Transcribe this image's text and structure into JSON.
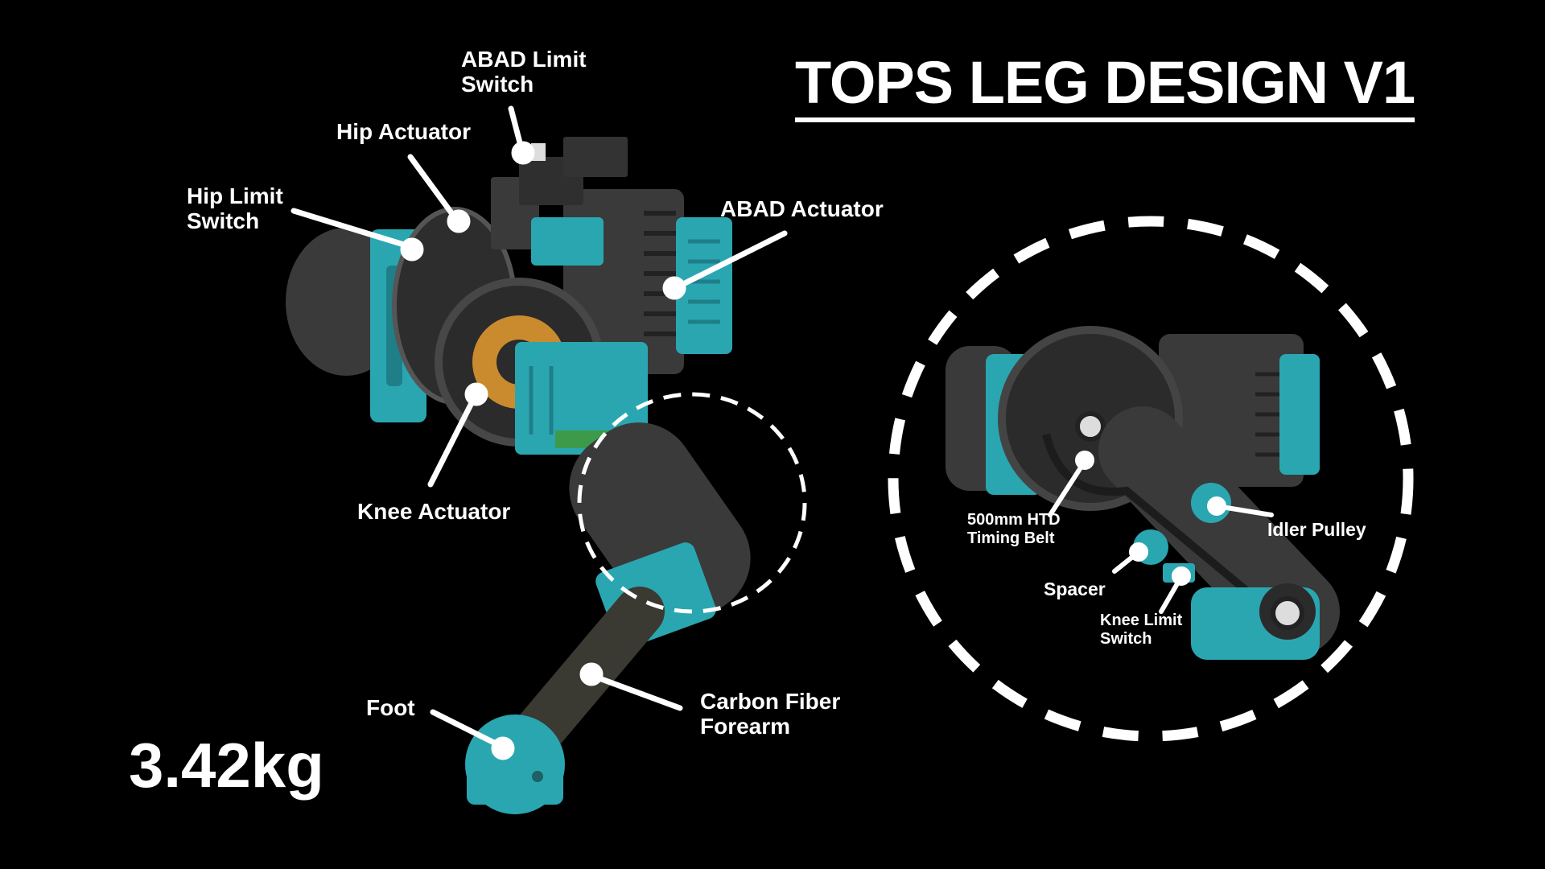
{
  "title": "TOPS LEG DESIGN V1",
  "mass": "3.42kg",
  "colors": {
    "background": "#000000",
    "accent_teal": "#2aa6b1",
    "dark_part": "#3a3a3a",
    "motor_copper": "#c98b2e",
    "text": "#ffffff"
  },
  "callouts": {
    "abad_limit_switch": [
      "ABAD Limit",
      "Switch"
    ],
    "hip_actuator": "Hip Actuator",
    "hip_limit_switch": [
      "Hip Limit",
      "Switch"
    ],
    "abad_actuator": "ABAD Actuator",
    "knee_actuator": "Knee Actuator",
    "foot": "Foot",
    "carbon_fiber_forearm": [
      "Carbon Fiber",
      "Forearm"
    ]
  },
  "detail_callouts": {
    "timing_belt": [
      "500mm HTD",
      "Timing Belt"
    ],
    "idler_pulley": "Idler Pulley",
    "spacer": "Spacer",
    "knee_limit_switch": [
      "Knee Limit",
      "Switch"
    ]
  }
}
